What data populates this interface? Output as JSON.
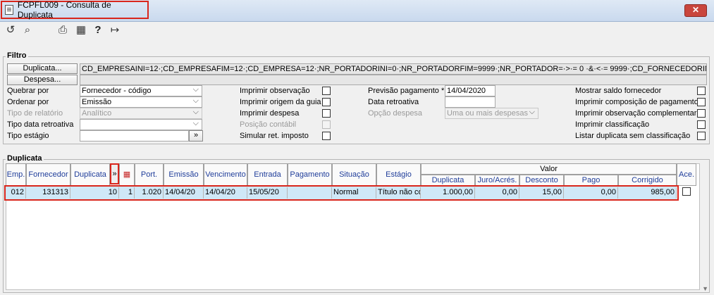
{
  "window": {
    "title": "FCPFL009 - Consulta de Duplicata",
    "close_label": "✕"
  },
  "toolbar": [
    {
      "name": "refresh-icon",
      "glyph": "↺"
    },
    {
      "name": "search-icon",
      "glyph": "⌕"
    },
    {
      "name": "print-icon",
      "glyph": "⎙"
    },
    {
      "name": "grid-icon",
      "glyph": "▦"
    },
    {
      "name": "help-icon",
      "glyph": "?"
    },
    {
      "name": "exit-icon",
      "glyph": "↦"
    }
  ],
  "filtro": {
    "title": "Filtro",
    "duplicata_btn": "Duplicata...",
    "despesa_btn": "Despesa...",
    "duplicata_value": "CD_EMPRESAINI=12·;CD_EMPRESAFIM=12·;CD_EMPRESA=12·;NR_PORTADORINI=0·;NR_PORTADORFIM=9999·;NR_PORTADOR=·>·= 0 ·&·<·= 9999·;CD_FORNECEDORINI=131313·;CD_",
    "quebrar_label": "Quebrar por",
    "quebrar_value": "Fornecedor - código",
    "ordenar_label": "Ordenar por",
    "ordenar_value": "Emissão",
    "tipo_relatorio_label": "Tipo de relatório",
    "tipo_relatorio_value": "Analítico",
    "tipo_data_label": "Tipo data retroativa",
    "tipo_data_value": "",
    "tipo_estagio_label": "Tipo estágio",
    "tipo_estagio_btn": "»",
    "imprimir_obs": "Imprimir observação",
    "imprimir_origem": "Imprimir origem da guia",
    "imprimir_despesa": "Imprimir despesa",
    "posicao_contabil": "Posição contábil",
    "simular_ret": "Simular ret. imposto",
    "previsao_label": "Previsão pagamento *",
    "previsao_value": "14/04/2020",
    "data_retro_label": "Data retroativa",
    "data_retro_value": "",
    "opcao_despesa_label": "Opção despesa",
    "opcao_despesa_value": "Uma ou mais despesas",
    "mostrar_saldo": "Mostrar saldo fornecedor",
    "imprimir_comp": "Imprimir composição de pagamento",
    "imprimir_obs_comp": "Imprimir observação complementar",
    "imprimir_class": "Imprimir classificação",
    "listar_dup": "Listar duplicata sem classificação"
  },
  "duplicata": {
    "title": "Duplicata",
    "headers": {
      "emp": "Emp.",
      "fornecedor": "Fornecedor",
      "duplicata": "Duplicata",
      "expand": "»",
      "port": "Port.",
      "emissao": "Emissão",
      "vencimento": "Vencimento",
      "entrada": "Entrada",
      "pagamento": "Pagamento",
      "situacao": "Situação",
      "estagio": "Estágio",
      "valor": "Valor",
      "v_duplicata": "Duplicata",
      "juro": "Juro/Acrés.",
      "desconto": "Desconto",
      "pago": "Pago",
      "corrigido": "Corrigido",
      "ace": "Ace."
    },
    "row": {
      "emp": "012",
      "fornecedor": "131313",
      "duplicata": "10",
      "parcela": "1",
      "port": "1.020",
      "emissao": "14/04/20",
      "vencimento": "14/04/20",
      "entrada": "15/05/20",
      "pagamento": "",
      "situacao": "Normal",
      "estagio": "Título não co",
      "v_duplicata": "1.000,00",
      "juro": "0,00",
      "desconto": "15,00",
      "pago": "0,00",
      "corrigido": "985,00"
    }
  },
  "colors": {
    "accent_red": "#d9261c",
    "header_text": "#1f3d9a",
    "row_highlight": "#cfe8f7"
  }
}
